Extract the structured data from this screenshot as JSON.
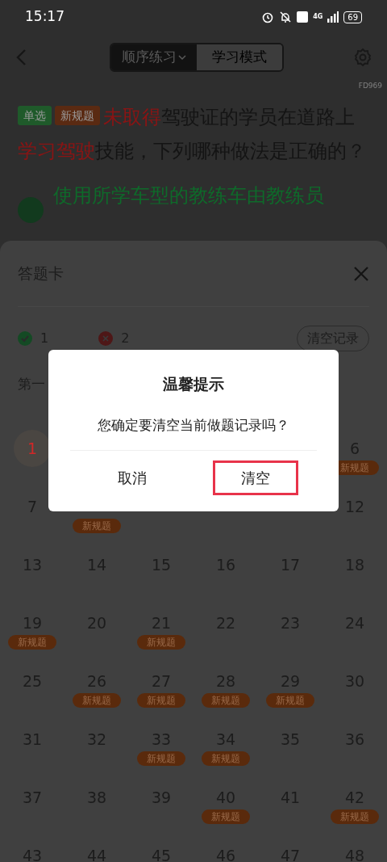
{
  "status_bar": {
    "time": "15:17",
    "battery": "69",
    "network": "4G"
  },
  "header": {
    "tabs": [
      {
        "label": "顺序练习",
        "selected": true,
        "dropdown": true
      },
      {
        "label": "学习模式",
        "selected": false,
        "dropdown": false
      }
    ],
    "code": "FD969"
  },
  "question": {
    "tags": [
      {
        "label": "单选",
        "color": "#1f5a2a"
      },
      {
        "label": "新规题",
        "color": "#5a2a12"
      }
    ],
    "segments": [
      {
        "text": "未取得",
        "highlight": true
      },
      {
        "text": "驾驶证的学员在道路上",
        "highlight": false
      },
      {
        "text": "学习驾驶",
        "highlight": true
      },
      {
        "text": "技能，下列哪种做法是正确的？",
        "highlight": false
      }
    ],
    "option": "使用所学车型的教练车由教练员"
  },
  "sheet": {
    "title": "答题卡",
    "correct": "1",
    "wrong": "2",
    "clear_button": "清空记录",
    "section": "第一",
    "cells": [
      {
        "number": "1",
        "current": true
      },
      {},
      {},
      {},
      {},
      {
        "number": "6",
        "badge": "新规题"
      },
      {
        "number": "7"
      },
      {
        "badge": "新规题"
      },
      {},
      {},
      {},
      {
        "number": "12"
      },
      {
        "number": "13"
      },
      {
        "number": "14"
      },
      {
        "number": "15"
      },
      {
        "number": "16"
      },
      {
        "number": "17"
      },
      {
        "number": "18"
      },
      {
        "number": "19",
        "badge": "新规题"
      },
      {
        "number": "20"
      },
      {
        "number": "21",
        "badge": "新规题"
      },
      {
        "number": "22"
      },
      {
        "number": "23"
      },
      {
        "number": "24"
      },
      {
        "number": "25"
      },
      {
        "number": "26",
        "badge": "新规题"
      },
      {
        "number": "27",
        "badge": "新规题"
      },
      {
        "number": "28",
        "badge": "新规题"
      },
      {
        "number": "29",
        "badge": "新规题"
      },
      {
        "number": "30"
      },
      {
        "number": "31"
      },
      {
        "number": "32"
      },
      {
        "number": "33",
        "badge": "新规题"
      },
      {
        "number": "34",
        "badge": "新规题"
      },
      {
        "number": "35"
      },
      {
        "number": "36"
      },
      {
        "number": "37"
      },
      {
        "number": "38"
      },
      {
        "number": "39"
      },
      {
        "number": "40",
        "badge": "新规题"
      },
      {
        "number": "41"
      },
      {
        "number": "42",
        "badge": "新规题"
      },
      {
        "number": "43"
      },
      {
        "number": "44"
      },
      {
        "number": "45"
      },
      {
        "number": "46"
      },
      {
        "number": "47"
      },
      {
        "number": "48"
      }
    ]
  },
  "dialog": {
    "title": "温馨提示",
    "message": "您确定要清空当前做题记录吗？",
    "buttons": [
      {
        "label": "取消",
        "highlighted": false
      },
      {
        "label": "清空",
        "highlighted": true
      }
    ]
  }
}
